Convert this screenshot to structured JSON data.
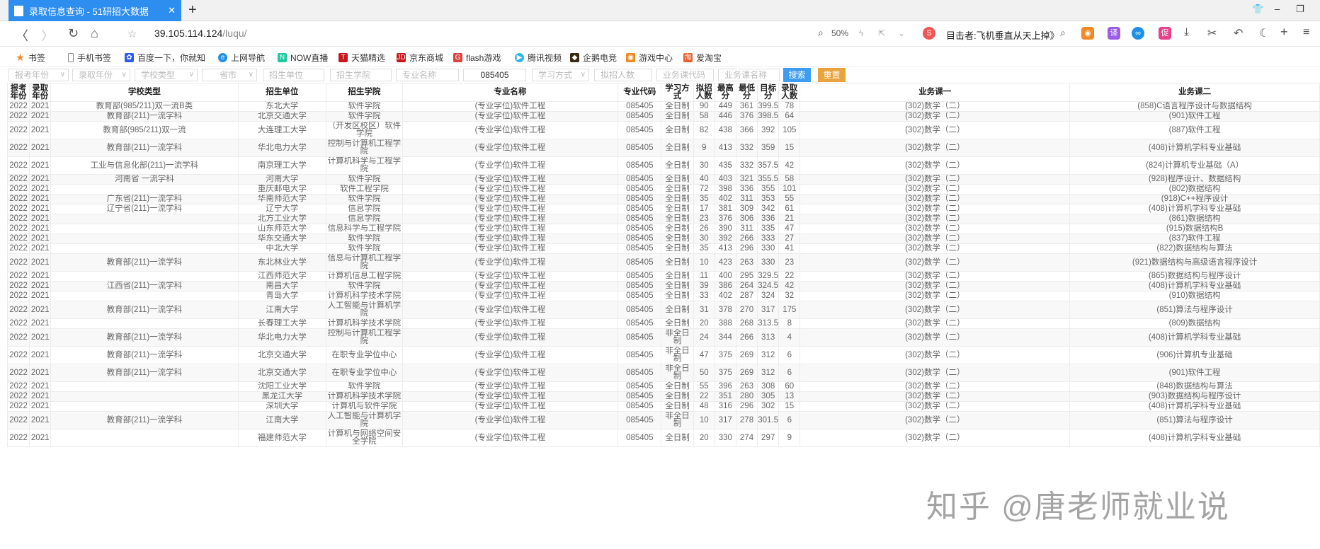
{
  "browser": {
    "tab_title": "录取信息查询 - 51研招大数据",
    "url_host": "39.105.114.124",
    "url_path": "/luqu/",
    "zoom": "50%",
    "search_text": "目击者:飞机垂直从天上掉》",
    "ext_icons": [
      "game-icon",
      "translate-icon",
      "infinity-icon",
      "promo-icon"
    ],
    "ext_labels": [
      "译",
      "∞",
      "促"
    ]
  },
  "bookmarks": [
    "书签",
    "手机书签",
    "百度一下，你就知",
    "上网导航",
    "NOW直播",
    "天猫精选",
    "京东商城",
    "flash游戏",
    "腾讯视频",
    "企鹅电竞",
    "游戏中心",
    "爱淘宝"
  ],
  "filters": {
    "selects": [
      "报考年份",
      "录取年份",
      "学校类型",
      "省市"
    ],
    "inputs": [
      "招生单位",
      "招生学院",
      "专业名称"
    ],
    "major_code": "085405",
    "study_mode": "学习方式",
    "inputs2": [
      "拟招人数",
      "业务课代码",
      "业务课名称"
    ],
    "search": "搜索",
    "reset": "重置"
  },
  "colors": {
    "accent": "#2e8ef0",
    "search": "#3d9df2",
    "reset": "#e8a33d"
  },
  "table": {
    "headers": [
      "报考年份",
      "录取年份",
      "学校类型",
      "招生单位",
      "招生学院",
      "专业名称",
      "专业代码",
      "学习方式",
      "拟招人数",
      "最高分",
      "最低分",
      "目标分",
      "录取人数",
      "业务课一",
      "业务课二"
    ],
    "rows": [
      [
        "2022",
        "2021",
        "教育部(985/211)双一流B类",
        "东北大学",
        "软件学院",
        "(专业学位)软件工程",
        "085405",
        "全日制",
        "90",
        "449",
        "361",
        "399.5",
        "78",
        "(302)数学（二）",
        "(858)C语言程序设计与数据结构"
      ],
      [
        "2022",
        "2021",
        "教育部(211)一流学科",
        "北京交通大学",
        "软件学院",
        "(专业学位)软件工程",
        "085405",
        "全日制",
        "58",
        "446",
        "376",
        "398.5",
        "64",
        "(302)数学（二）",
        "(901)软件工程"
      ],
      [
        "2022",
        "2021",
        "教育部(985/211)双一流",
        "大连理工大学",
        "（开发区校区）软件学院",
        "(专业学位)软件工程",
        "085405",
        "全日制",
        "82",
        "438",
        "366",
        "392",
        "105",
        "(302)数学（二）",
        "(887)软件工程"
      ],
      [
        "2022",
        "2021",
        "教育部(211)一流学科",
        "华北电力大学",
        "控制与计算机工程学院",
        "(专业学位)软件工程",
        "085405",
        "全日制",
        "9",
        "413",
        "332",
        "359",
        "15",
        "(302)数学（二）",
        "(408)计算机学科专业基础"
      ],
      [
        "2022",
        "2021",
        "工业与信息化部(211)一流学科",
        "南京理工大学",
        "计算机科学与工程学院",
        "(专业学位)软件工程",
        "085405",
        "全日制",
        "30",
        "435",
        "332",
        "357.5",
        "42",
        "(302)数学（二）",
        "(824)计算机专业基础（A）"
      ],
      [
        "2022",
        "2021",
        "河南省 一流学科",
        "河南大学",
        "软件学院",
        "(专业学位)软件工程",
        "085405",
        "全日制",
        "40",
        "403",
        "321",
        "355.5",
        "58",
        "(302)数学（二）",
        "(928)程序设计、数据结构"
      ],
      [
        "2022",
        "2021",
        "",
        "重庆邮电大学",
        "软件工程学院",
        "(专业学位)软件工程",
        "085405",
        "全日制",
        "72",
        "398",
        "336",
        "355",
        "101",
        "(302)数学（二）",
        "(802)数据结构"
      ],
      [
        "2022",
        "2021",
        "广东省(211)一流学科",
        "华南师范大学",
        "软件学院",
        "(专业学位)软件工程",
        "085405",
        "全日制",
        "35",
        "402",
        "311",
        "353",
        "55",
        "(302)数学（二）",
        "(918)C++程序设计"
      ],
      [
        "2022",
        "2021",
        "辽宁省(211)一流学科",
        "辽宁大学",
        "信息学院",
        "(专业学位)软件工程",
        "085405",
        "全日制",
        "17",
        "381",
        "309",
        "342",
        "61",
        "(302)数学（二）",
        "(408)计算机学科专业基础"
      ],
      [
        "2022",
        "2021",
        "",
        "北方工业大学",
        "信息学院",
        "(专业学位)软件工程",
        "085405",
        "全日制",
        "23",
        "376",
        "306",
        "336",
        "21",
        "(302)数学（二）",
        "(861)数据结构"
      ],
      [
        "2022",
        "2021",
        "",
        "山东师范大学",
        "信息科学与工程学院",
        "(专业学位)软件工程",
        "085405",
        "全日制",
        "26",
        "390",
        "311",
        "335",
        "47",
        "(302)数学（二）",
        "(915)数据结构B"
      ],
      [
        "2022",
        "2021",
        "",
        "华东交通大学",
        "软件学院",
        "(专业学位)软件工程",
        "085405",
        "全日制",
        "30",
        "392",
        "266",
        "333",
        "27",
        "(302)数学（二）",
        "(837)软件工程"
      ],
      [
        "2022",
        "2021",
        "",
        "中北大学",
        "软件学院",
        "(专业学位)软件工程",
        "085405",
        "全日制",
        "35",
        "413",
        "296",
        "330",
        "41",
        "(302)数学（二）",
        "(822)数据结构与算法"
      ],
      [
        "2022",
        "2021",
        "教育部(211)一流学科",
        "东北林业大学",
        "信息与计算机工程学院",
        "(专业学位)软件工程",
        "085405",
        "全日制",
        "10",
        "423",
        "263",
        "330",
        "23",
        "(302)数学（二）",
        "(921)数据结构与高级语言程序设计"
      ],
      [
        "2022",
        "2021",
        "",
        "江西师范大学",
        "计算机信息工程学院",
        "(专业学位)软件工程",
        "085405",
        "全日制",
        "11",
        "400",
        "295",
        "329.5",
        "22",
        "(302)数学（二）",
        "(865)数据结构与程序设计"
      ],
      [
        "2022",
        "2021",
        "江西省(211)一流学科",
        "南昌大学",
        "软件学院",
        "(专业学位)软件工程",
        "085405",
        "全日制",
        "39",
        "386",
        "264",
        "324.5",
        "42",
        "(302)数学（二）",
        "(408)计算机学科专业基础"
      ],
      [
        "2022",
        "2021",
        "",
        "青岛大学",
        "计算机科学技术学院",
        "(专业学位)软件工程",
        "085405",
        "全日制",
        "33",
        "402",
        "287",
        "324",
        "32",
        "(302)数学（二）",
        "(910)数据结构"
      ],
      [
        "2022",
        "2021",
        "教育部(211)一流学科",
        "江南大学",
        "人工智能与计算机学院",
        "(专业学位)软件工程",
        "085405",
        "全日制",
        "31",
        "378",
        "270",
        "317",
        "175",
        "(302)数学（二）",
        "(851)算法与程序设计"
      ],
      [
        "2022",
        "2021",
        "",
        "长春理工大学",
        "计算机科学技术学院",
        "(专业学位)软件工程",
        "085405",
        "全日制",
        "20",
        "388",
        "268",
        "313.5",
        "8",
        "(302)数学（二）",
        "(809)数据结构"
      ],
      [
        "2022",
        "2021",
        "教育部(211)一流学科",
        "华北电力大学",
        "控制与计算机工程学院",
        "(专业学位)软件工程",
        "085405",
        "非全日制",
        "24",
        "344",
        "266",
        "313",
        "4",
        "(302)数学（二）",
        "(408)计算机学科专业基础"
      ],
      [
        "2022",
        "2021",
        "教育部(211)一流学科",
        "北京交通大学",
        "在职专业学位中心",
        "(专业学位)软件工程",
        "085405",
        "非全日制",
        "47",
        "375",
        "269",
        "312",
        "6",
        "(302)数学（二）",
        "(906)计算机专业基础"
      ],
      [
        "2022",
        "2021",
        "教育部(211)一流学科",
        "北京交通大学",
        "在职专业学位中心",
        "(专业学位)软件工程",
        "085405",
        "非全日制",
        "50",
        "375",
        "269",
        "312",
        "6",
        "(302)数学（二）",
        "(901)软件工程"
      ],
      [
        "2022",
        "2021",
        "",
        "沈阳工业大学",
        "软件学院",
        "(专业学位)软件工程",
        "085405",
        "全日制",
        "55",
        "396",
        "263",
        "308",
        "60",
        "(302)数学（二）",
        "(848)数据结构与算法"
      ],
      [
        "2022",
        "2021",
        "",
        "黑龙江大学",
        "计算机科学技术学院",
        "(专业学位)软件工程",
        "085405",
        "全日制",
        "22",
        "351",
        "280",
        "305",
        "13",
        "(302)数学（二）",
        "(903)数据结构与程序设计"
      ],
      [
        "2022",
        "2021",
        "",
        "深圳大学",
        "计算机与软件学院",
        "(专业学位)软件工程",
        "085405",
        "全日制",
        "48",
        "316",
        "296",
        "302",
        "15",
        "(302)数学（二）",
        "(408)计算机学科专业基础"
      ],
      [
        "2022",
        "2021",
        "教育部(211)一流学科",
        "江南大学",
        "人工智能与计算机学院",
        "(专业学位)软件工程",
        "085405",
        "非全日制",
        "10",
        "317",
        "278",
        "301.5",
        "6",
        "(302)数学（二）",
        "(851)算法与程序设计"
      ],
      [
        "2022",
        "2021",
        "",
        "福建师范大学",
        "计算机与网络空间安全学院",
        "(专业学位)软件工程",
        "085405",
        "全日制",
        "20",
        "330",
        "274",
        "297",
        "9",
        "(302)数学（二）",
        "(408)计算机学科专业基础"
      ]
    ]
  },
  "watermark": "知乎 @唐老师就业说"
}
